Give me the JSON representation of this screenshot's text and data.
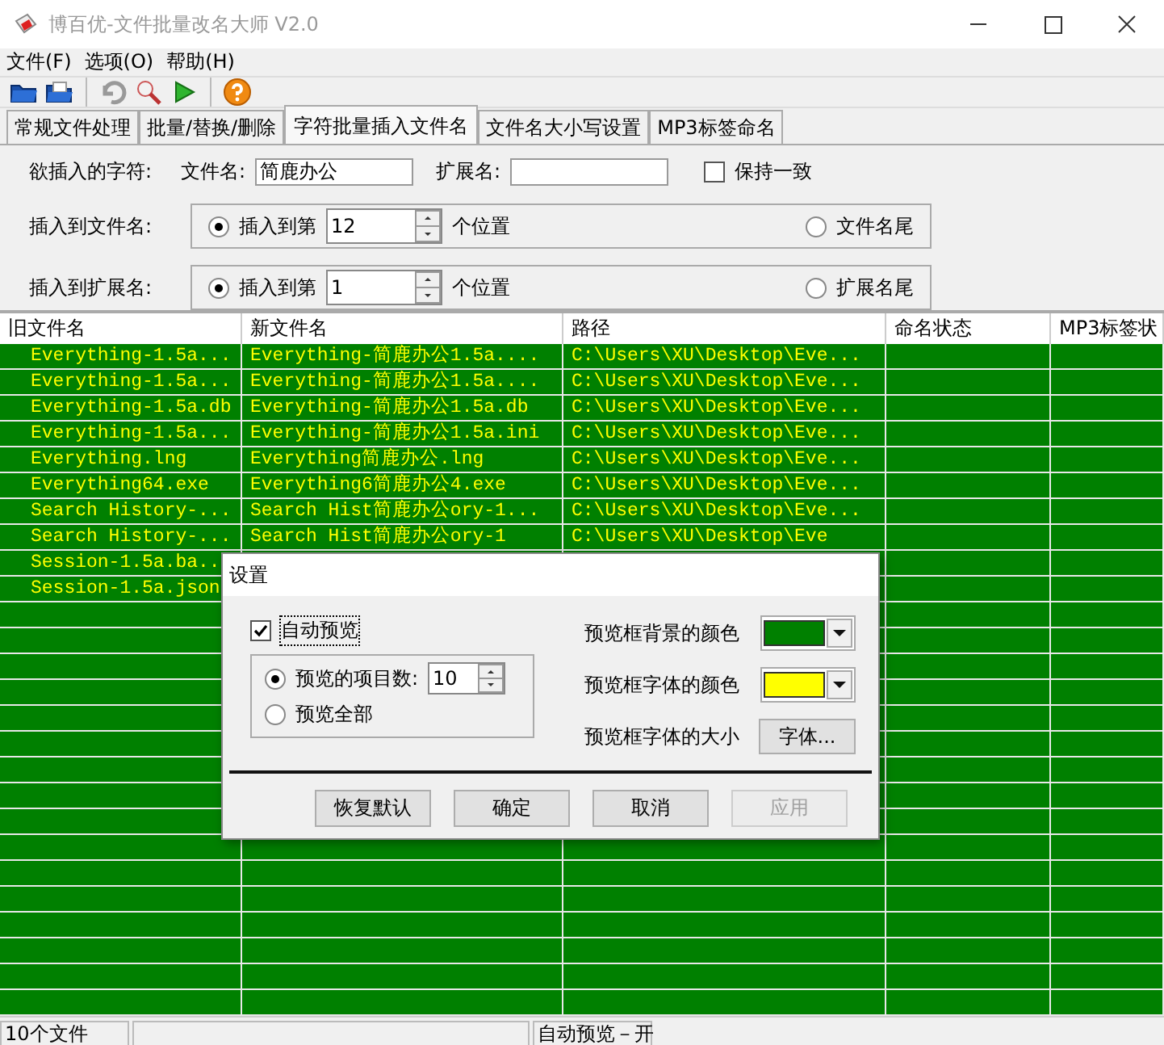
{
  "window": {
    "title": "博百优-文件批量改名大师 V2.0"
  },
  "menu": [
    "文件(F)",
    "选项(O)",
    "帮助(H)"
  ],
  "tabs": [
    {
      "label": "常规文件处理",
      "selected": false
    },
    {
      "label": "批量/替换/删除",
      "selected": false
    },
    {
      "label": "字符批量插入文件名",
      "selected": true
    },
    {
      "label": "文件名大小写设置",
      "selected": false
    },
    {
      "label": "MP3标签命名",
      "selected": false
    }
  ],
  "insert_panel": {
    "label": "欲插入的字符:",
    "filename_label": "文件名:",
    "filename_value": "简鹿办公",
    "ext_label": "扩展名:",
    "keep_same": {
      "label": "保持一致",
      "checked": false
    },
    "groups": [
      {
        "label": "插入到文件名:",
        "options": [
          {
            "label": "插入到第",
            "selected": true,
            "value": "12",
            "suffix": "个位置"
          },
          {
            "label": "文件名尾",
            "selected": false
          }
        ]
      },
      {
        "label": "插入到扩展名:",
        "options": [
          {
            "label": "插入到第",
            "selected": true,
            "value": "1",
            "suffix": "个位置"
          },
          {
            "label": "扩展名尾",
            "selected": false
          }
        ]
      }
    ]
  },
  "table": {
    "columns": [
      "旧文件名",
      "新文件名",
      "路径",
      "命名状态",
      "MP3标签状"
    ],
    "rows": [
      {
        "old": "Everything-1.5a...",
        "new": "Everything-简鹿办公1.5a....",
        "path": "C:\\Users\\XU\\Desktop\\Eve..."
      },
      {
        "old": "Everything-1.5a...",
        "new": "Everything-简鹿办公1.5a....",
        "path": "C:\\Users\\XU\\Desktop\\Eve..."
      },
      {
        "old": "Everything-1.5a.db",
        "new": "Everything-简鹿办公1.5a.db",
        "path": "C:\\Users\\XU\\Desktop\\Eve..."
      },
      {
        "old": "Everything-1.5a...",
        "new": "Everything-简鹿办公1.5a.ini",
        "path": "C:\\Users\\XU\\Desktop\\Eve..."
      },
      {
        "old": "Everything.lng",
        "new": "Everything简鹿办公.lng",
        "path": "C:\\Users\\XU\\Desktop\\Eve..."
      },
      {
        "old": "Everything64.exe",
        "new": "Everything6简鹿办公4.exe",
        "path": "C:\\Users\\XU\\Desktop\\Eve..."
      },
      {
        "old": "Search History-...",
        "new": "Search Hist简鹿办公ory-1...",
        "path": "C:\\Users\\XU\\Desktop\\Eve..."
      },
      {
        "old": "Search History-...",
        "new": "Search Hist简鹿办公ory-1",
        "path": "C:\\Users\\XU\\Desktop\\Eve"
      },
      {
        "old": "Session-1.5a.ba.."
      },
      {
        "old": "Session-1.5a.json"
      }
    ]
  },
  "dialog": {
    "title": "设置",
    "auto_preview": {
      "label": "自动预览",
      "checked": true
    },
    "count_options": [
      {
        "label": "预览的项目数:",
        "selected": true,
        "value": "10"
      },
      {
        "label": "预览全部",
        "selected": false
      }
    ],
    "bg_color": {
      "label": "预览框背景的颜色",
      "color": "#008000"
    },
    "font_color": {
      "label": "预览框字体的颜色",
      "color": "#ffff00"
    },
    "font_size": {
      "label": "预览框字体的大小",
      "button": "字体..."
    },
    "buttons": [
      {
        "label": "恢复默认",
        "disabled": false
      },
      {
        "label": "确定",
        "disabled": false
      },
      {
        "label": "取消",
        "disabled": false
      },
      {
        "label": "应用",
        "disabled": true
      }
    ]
  },
  "status_bar": {
    "file_count": "10个文件",
    "preview_state": "自动预览－开"
  }
}
